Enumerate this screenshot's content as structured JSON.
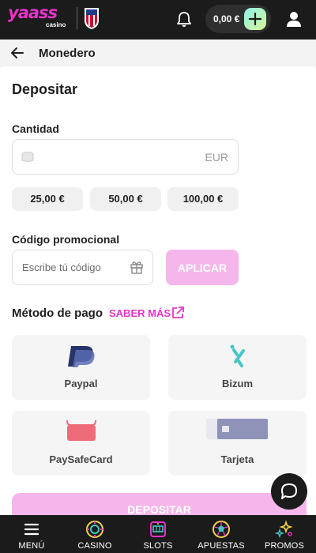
{
  "header": {
    "logo_text": "yaass",
    "logo_sub": "casino",
    "balance": "0,00 €",
    "icons": [
      "club-badge-icon",
      "bell-icon",
      "plus-icon",
      "user-icon"
    ],
    "colors": {
      "brand": "#e534c8",
      "bar": "#1b1b1b",
      "add_button": "#a9f2d8"
    }
  },
  "subheader": {
    "title": "Monedero",
    "back_icon": "arrow-left-icon"
  },
  "deposit": {
    "heading": "Depositar",
    "amount_label": "Cantidad",
    "amount_value": "",
    "currency": "EUR",
    "quick_amounts": [
      "25,00 €",
      "50,00 €",
      "100,00 €"
    ],
    "promo_label": "Código promocional",
    "promo_placeholder": "Escribe tú código",
    "apply_label": "APLICAR",
    "method_label": "Método de pago",
    "learn_more": "SABER MÁS",
    "methods": [
      {
        "name": "Paypal",
        "icon": "paypal-icon"
      },
      {
        "name": "Bizum",
        "icon": "bizum-icon"
      },
      {
        "name": "PaySafeCard",
        "icon": "paysafecard-icon"
      },
      {
        "name": "Tarjeta",
        "icon": "card-icon"
      }
    ],
    "submit_label": "DEPOSITAR",
    "button_color": "#f5b6ec"
  },
  "bottom_nav": {
    "items": [
      {
        "label": "MENÚ",
        "icon": "menu-icon"
      },
      {
        "label": "CASINO",
        "icon": "casino-chip-icon"
      },
      {
        "label": "SLOTS",
        "icon": "slot-machine-icon"
      },
      {
        "label": "APUESTAS",
        "icon": "football-icon"
      },
      {
        "label": "PROMOS",
        "icon": "promo-stars-icon"
      }
    ]
  }
}
